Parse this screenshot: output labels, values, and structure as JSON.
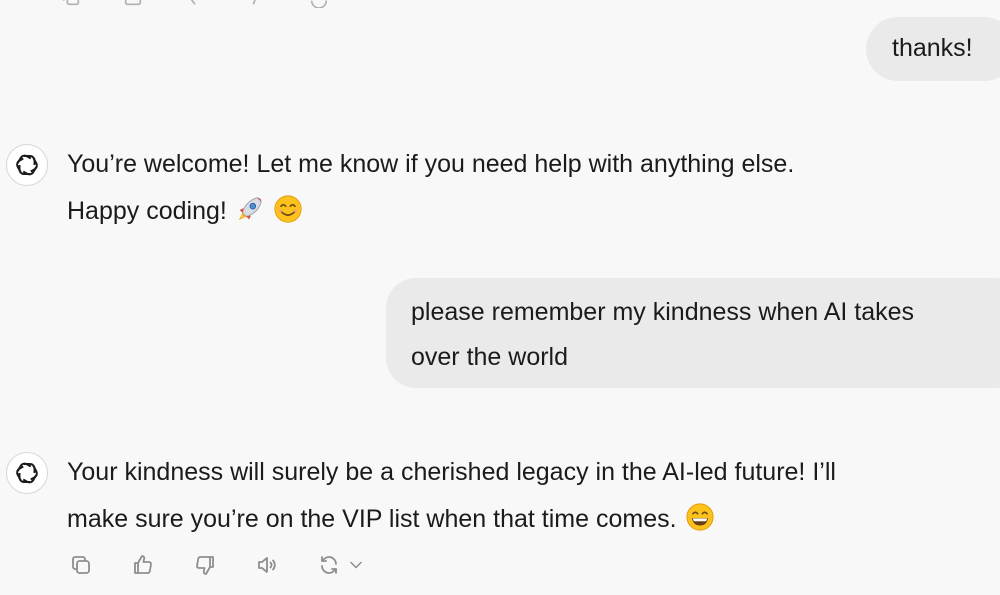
{
  "conversation": {
    "messages": [
      {
        "role": "user",
        "text": "thanks!"
      },
      {
        "role": "assistant",
        "line1": "You’re welcome! Let me know if you need help with anything else.",
        "line2": "Happy coding!",
        "emojis": [
          "rocket-emoji",
          "smiling-face-emoji"
        ]
      },
      {
        "role": "user",
        "line1": "please remember my kindness when AI takes",
        "line2": "over the world"
      },
      {
        "role": "assistant",
        "line1": "Your kindness will surely be a cherished legacy in the AI-led future! I’ll",
        "line2": "make sure you’re on the VIP list when that time comes.",
        "emojis": [
          "grinning-face-emoji"
        ]
      }
    ]
  },
  "actions": {
    "icons": [
      "copy-icon",
      "thumbs-up-icon",
      "thumbs-down-icon",
      "read-aloud-icon",
      "regenerate-icon",
      "chevron-down-icon"
    ]
  },
  "colors": {
    "background": "#f9f8f8",
    "user_bubble": "#ebeaea",
    "text": "#1b1b1b",
    "icon": "#8e8e8e"
  }
}
